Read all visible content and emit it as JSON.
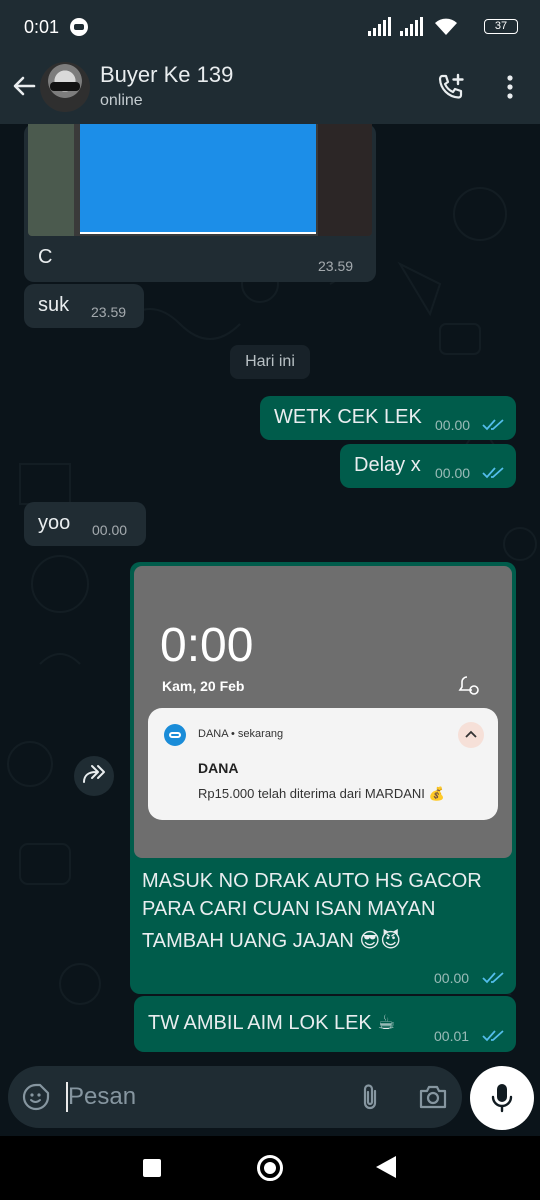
{
  "status_bar": {
    "time": "0:01",
    "battery": "37"
  },
  "header": {
    "name": "Buyer Ke 139",
    "status": "online"
  },
  "messages": [
    {
      "dir": "in",
      "text": "C",
      "time": "23.59",
      "has_image": true
    },
    {
      "dir": "in",
      "text": "suk",
      "time": "23.59"
    },
    {
      "dir": "out",
      "text": "WETK CEK LEK",
      "time": "00.00",
      "read": true
    },
    {
      "dir": "out",
      "text": "Delay x",
      "time": "00.00",
      "read": true
    },
    {
      "dir": "in",
      "text": "yoo",
      "time": "00.00"
    },
    {
      "dir": "out",
      "caption_lines": [
        "MASUK NO DRAK AUTO HS GACOR",
        "PARA CARI CUAN ISAN MAYAN",
        "TAMBAH UANG JAJAN 😎😈"
      ],
      "time": "00.00",
      "read": true,
      "screenshot": {
        "lock_time": "0:00",
        "lock_date": "Kam, 20 Feb",
        "notification": {
          "app": "DANA • sekarang",
          "title": "DANA",
          "body": "Rp15.000 telah diterima dari MARDANI 💰"
        }
      }
    },
    {
      "dir": "out",
      "text": "TW AMBIL AIM LOK LEK ☕",
      "time": "00.01",
      "read": true
    }
  ],
  "date_separator": "Hari ini",
  "input": {
    "placeholder": "Pesan"
  },
  "colors": {
    "outgoing_bubble": "#005c4b",
    "incoming_bubble": "#202c33",
    "read_ticks": "#53bdeb",
    "header": "#1f2c33"
  }
}
